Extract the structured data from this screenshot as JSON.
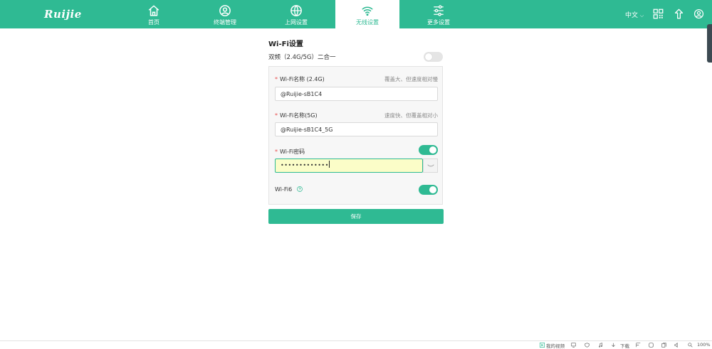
{
  "header": {
    "brand": "Ruijie",
    "nav": [
      {
        "label": "首页",
        "icon": "home-icon"
      },
      {
        "label": "终端管理",
        "icon": "user-circle-icon"
      },
      {
        "label": "上网设置",
        "icon": "globe-icon"
      },
      {
        "label": "无线设置",
        "icon": "wifi-icon",
        "active": true
      },
      {
        "label": "更多设置",
        "icon": "sliders-icon"
      }
    ],
    "language": "中文",
    "right_icons": [
      "qrcode-icon",
      "upgrade-icon",
      "account-icon"
    ]
  },
  "wifi": {
    "section_title": "Wi-Fi设置",
    "dual_band_label": "双频（2.4G/5G）二合一",
    "dual_band_enabled": false,
    "ssid_24": {
      "required_mark": "*",
      "label": "Wi-Fi名称 (2.4G)",
      "hint": "覆盖大、但速度相对慢",
      "value": "@Ruijie-sB1C4"
    },
    "ssid_5": {
      "required_mark": "*",
      "label": "Wi-Fi名称(5G)",
      "hint": "速度快、但覆盖相对小",
      "value": "@Ruijie-sB1C4_5G"
    },
    "password": {
      "required_mark": "*",
      "label": "Wi-Fi密码",
      "value": "•••••••••••••",
      "enabled": true
    },
    "wifi6": {
      "label": "Wi-Fi6",
      "enabled": true
    },
    "save_label": "保存"
  },
  "statusbar": {
    "video_label": "我的视频",
    "download_label": "下载",
    "zoom": "100%"
  },
  "colors": {
    "brand": "#2fba93",
    "password_field_bg": "#fbfdc8",
    "required": "#e84b4b"
  }
}
